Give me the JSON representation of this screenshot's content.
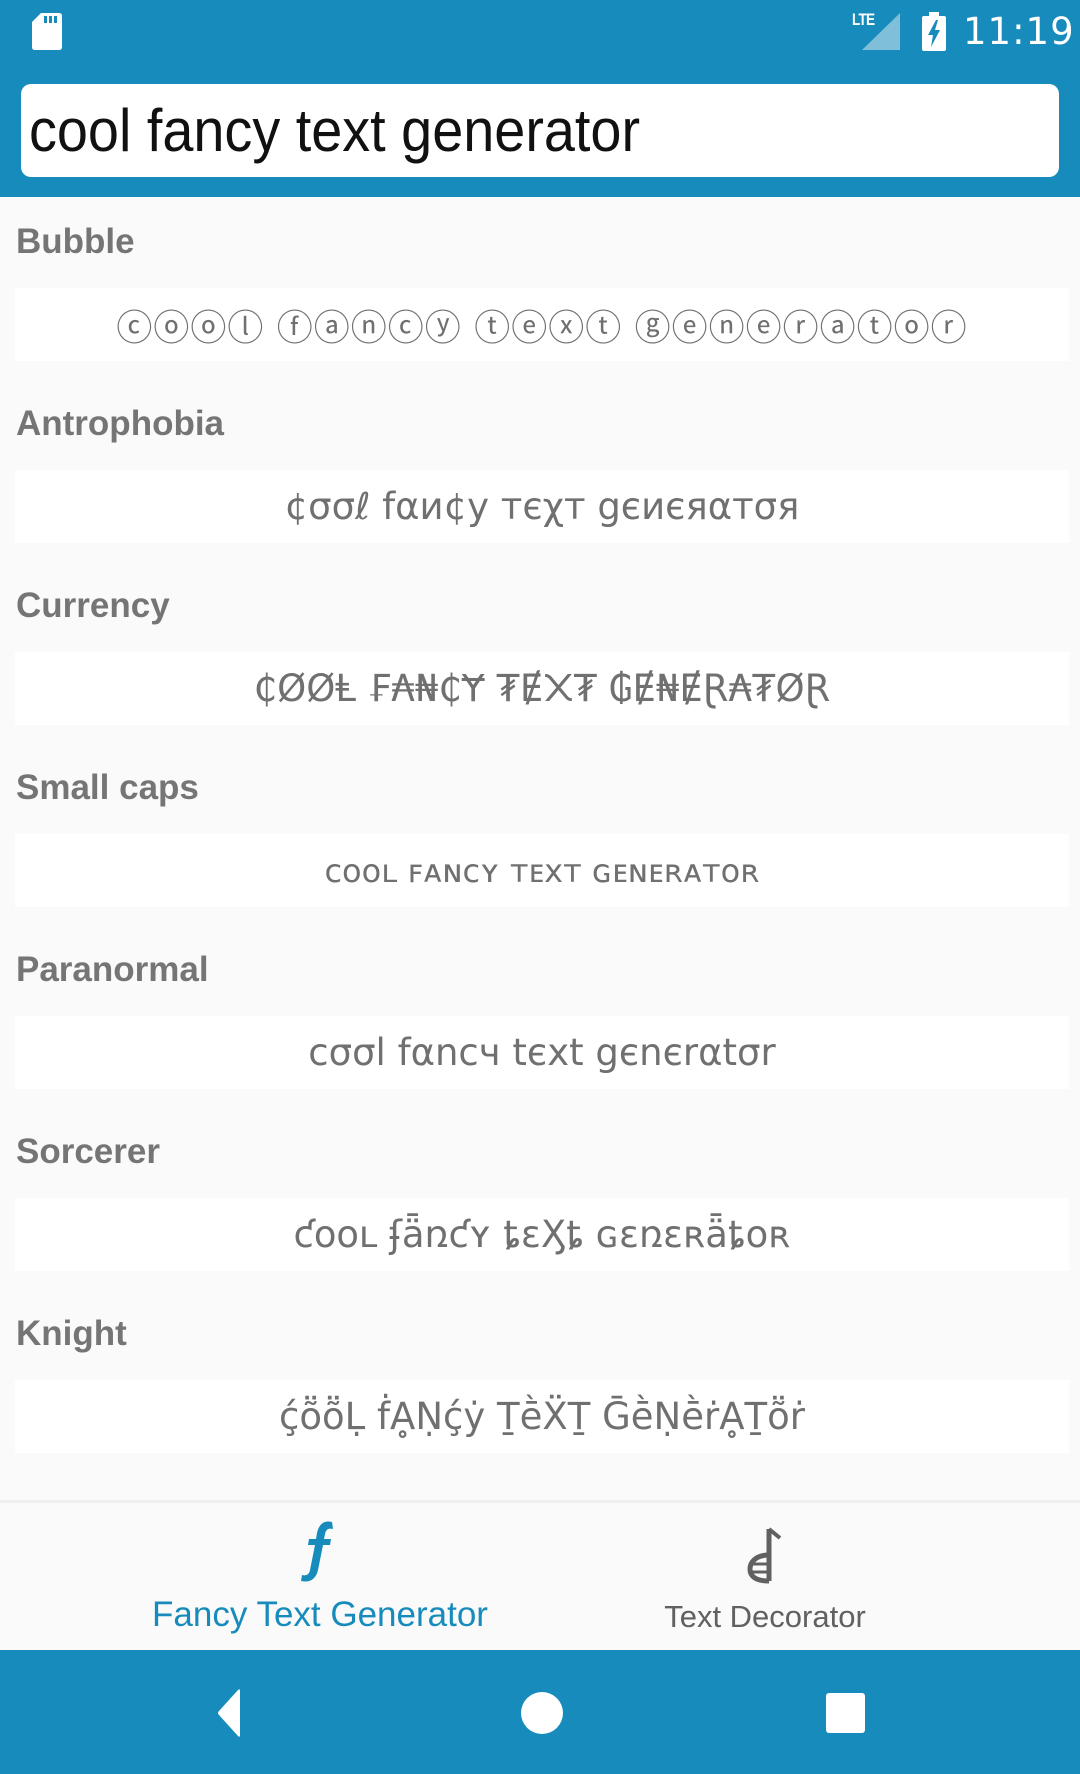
{
  "status_bar": {
    "network": "LTE",
    "time": "11:19",
    "icons": [
      "sd-card-icon",
      "lte-signal-icon",
      "battery-charging-icon"
    ]
  },
  "search": {
    "value": "cool fancy text generator",
    "placeholder": ""
  },
  "styles": [
    {
      "label": "Bubble",
      "text": "ⓒⓞⓞⓛ ⓕⓐⓝⓒⓨ ⓣⓔⓧⓣ ⓖⓔⓝⓔⓡⓐⓣⓞⓡ"
    },
    {
      "label": "Antrophobia",
      "text": "¢σσℓ fαи¢у тєχт gєиєяαтσя"
    },
    {
      "label": "Currency",
      "text": "₵ØØⱠ ₣₳₦₵Ɏ ₮Ɇ᙭₮ ₲Ɇ₦ɆⱤ₳₮ØⱤ"
    },
    {
      "label": "Small caps",
      "text": "ᴄᴏᴏʟ ꜰᴀɴᴄʏ ᴛᴇxᴛ ɢᴇɴᴇʀᴀᴛᴏʀ"
    },
    {
      "label": "Paranormal",
      "text": "cσσl fαncч tєxt gєnєrαtσr"
    },
    {
      "label": "Sorcerer",
      "text": "ƈօօʟ ʄǟռƈʏ ȶɛӼȶ ɢɛռɛʀǟȶօʀ"
    },
    {
      "label": "Knight",
      "text": "ḉṏṏḶ ḟḀṆḉẏ ṮḕẌṮ ḠḕṆḕṙḀṮṏṙ"
    }
  ],
  "bottom_nav": {
    "tabs": [
      {
        "label": "Fancy Text Generator",
        "icon": "fancy-f-icon",
        "active": true
      },
      {
        "label": "Text Decorator",
        "icon": "text-decorator-icon",
        "active": false
      }
    ],
    "active_color": "#178bbb",
    "inactive_color": "#616161"
  },
  "system_nav": {
    "buttons": [
      "back",
      "home",
      "recents"
    ]
  },
  "colors": {
    "primary": "#178bbb",
    "background": "#fafafa",
    "card": "#ffffff",
    "label_text": "#757575"
  }
}
